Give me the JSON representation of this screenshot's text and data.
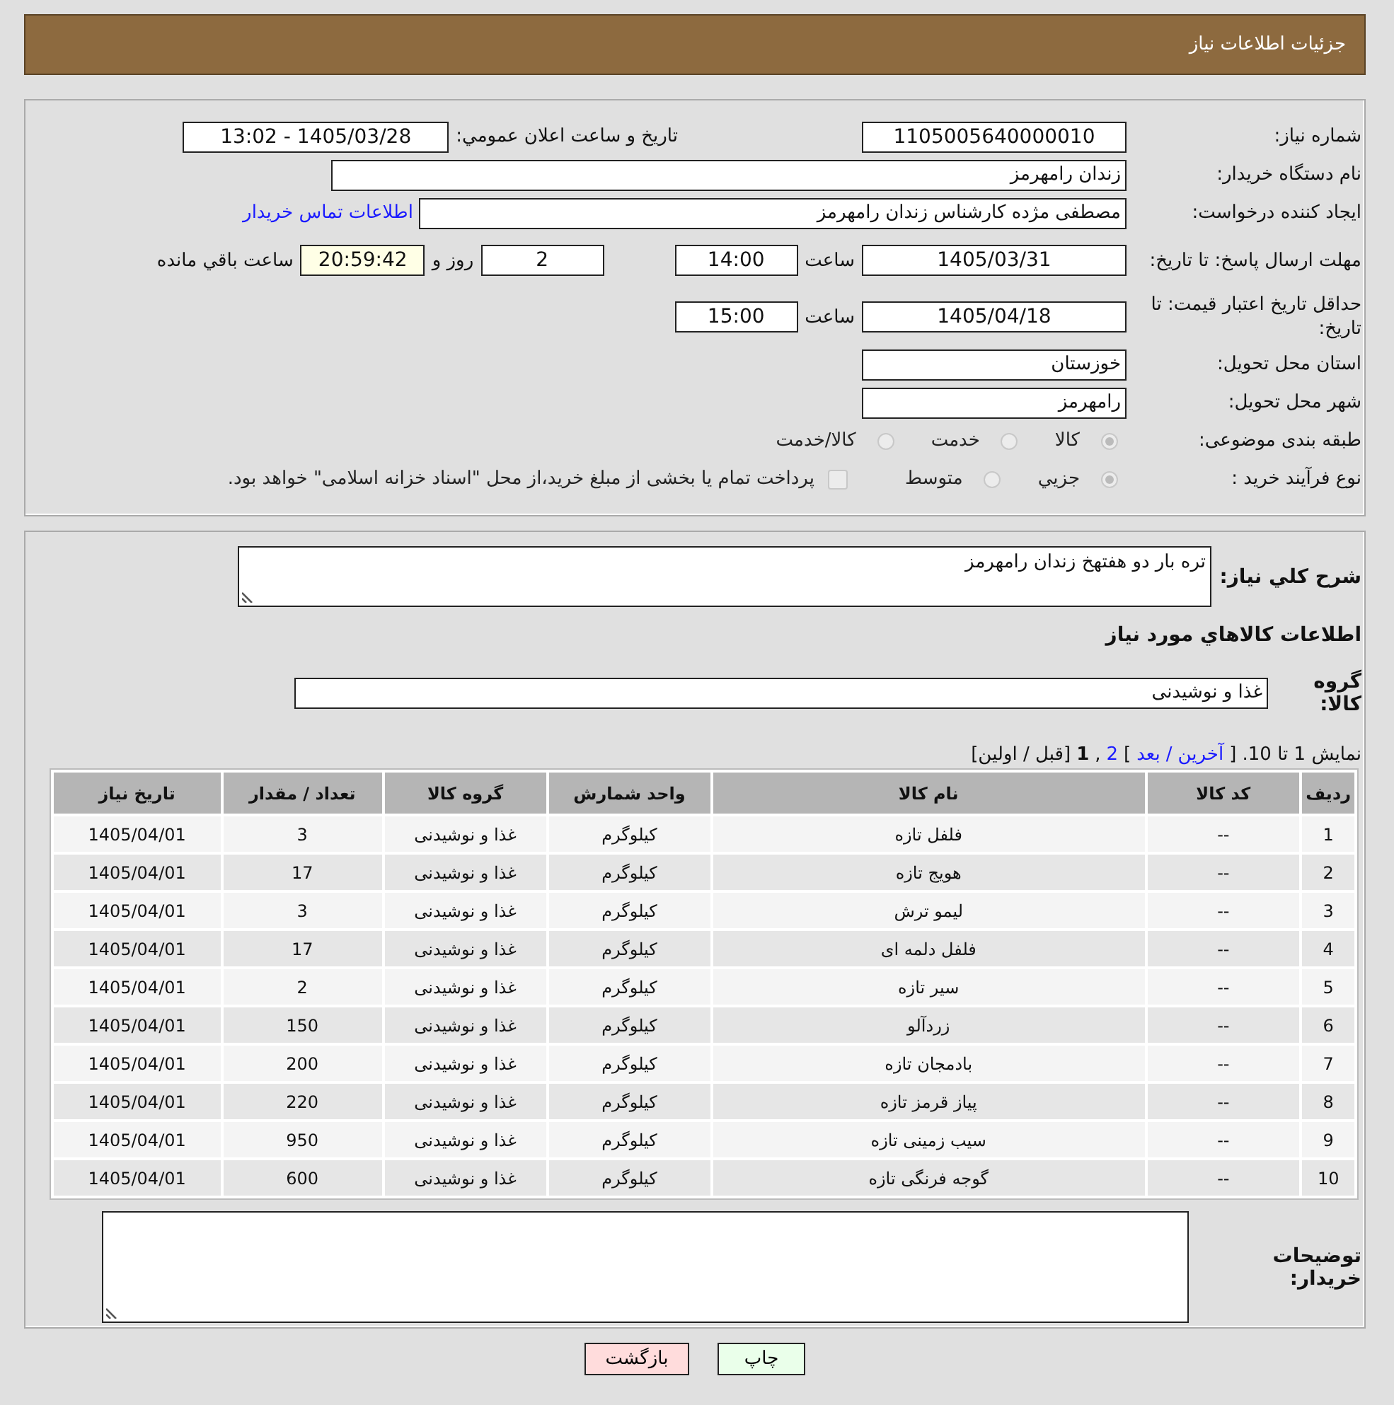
{
  "header": {
    "title": "جزئیات اطلاعات نیاز"
  },
  "details": {
    "need_number": {
      "label": "شماره نیاز:",
      "value": "1105005640000010"
    },
    "announce": {
      "label": "تاریخ و ساعت اعلان عمومي:",
      "value": "1405/03/28 - 13:02"
    },
    "buyer_org": {
      "label": "نام دستگاه خریدار:",
      "value": "زندان رامهرمز"
    },
    "requester": {
      "label": "ایجاد کننده درخواست:",
      "value": "مصطفی مژده کارشناس زندان رامهرمز",
      "link": "اطلاعات تماس خریدار"
    },
    "reply_deadline": {
      "label": "مهلت ارسال پاسخ: تا تاریخ:",
      "date": "1405/03/31",
      "time_label": "ساعت",
      "time": "14:00",
      "days": "2",
      "days_label": "روز و",
      "remaining": "20:59:42",
      "remaining_label": "ساعت باقي مانده"
    },
    "price_validity": {
      "label": "حداقل تاریخ اعتبار قیمت: تا تاریخ:",
      "date": "1405/04/18",
      "time_label": "ساعت",
      "time": "15:00"
    },
    "province": {
      "label": "استان محل تحویل:",
      "value": "خوزستان"
    },
    "city": {
      "label": "شهر محل تحویل:",
      "value": "رامهرمز"
    },
    "category": {
      "label": "طبقه بندی موضوعی:",
      "options": [
        {
          "label": "كالا",
          "selected": true
        },
        {
          "label": "خدمت",
          "selected": false
        },
        {
          "label": "كالا/خدمت",
          "selected": false
        }
      ]
    },
    "purchase_type": {
      "label": "نوع فرآیند خرید :",
      "options": [
        {
          "label": "جزيي",
          "selected": true
        },
        {
          "label": "متوسط",
          "selected": false
        }
      ],
      "treasury": {
        "label": "پرداخت تمام یا بخشی از مبلغ خرید،از محل \"اسناد خزانه اسلامی\" خواهد بود.",
        "checked": false
      }
    }
  },
  "need": {
    "description_label": "شرح كلي نياز:",
    "description": "تره بار دو هفتهخ زندان رامهرمز",
    "items_heading": "اطلاعات كالاهاي مورد نياز",
    "group_label": "گروه کالا:",
    "group": "غذا و نوشیدنی",
    "pagination": [
      {
        "kind": "text",
        "text": "نمایش 1 تا 10. ["
      },
      {
        "kind": "link",
        "text": "آخرین"
      },
      {
        "kind": "link",
        "text": "/"
      },
      {
        "kind": "link",
        "text": "بعد"
      },
      {
        "kind": "text",
        "text": "]"
      },
      {
        "kind": "link",
        "text": "2"
      },
      {
        "kind": "text",
        "text": ","
      },
      {
        "kind": "current",
        "text": "1"
      },
      {
        "kind": "text",
        "text": "[قبل / اولین]"
      }
    ],
    "table": {
      "columns": [
        "ردیف",
        "کد کالا",
        "نام کالا",
        "واحد شمارش",
        "گروه کالا",
        "تعداد / مقدار",
        "تاریخ نیاز"
      ],
      "rows": [
        [
          "1",
          "--",
          "فلفل تازه",
          "کیلوگرم",
          "غذا و نوشیدنی",
          "3",
          "1405/04/01"
        ],
        [
          "2",
          "--",
          "هویج تازه",
          "کیلوگرم",
          "غذا و نوشیدنی",
          "17",
          "1405/04/01"
        ],
        [
          "3",
          "--",
          "لیمو ترش",
          "کیلوگرم",
          "غذا و نوشیدنی",
          "3",
          "1405/04/01"
        ],
        [
          "4",
          "--",
          "فلفل دلمه ای",
          "کیلوگرم",
          "غذا و نوشیدنی",
          "17",
          "1405/04/01"
        ],
        [
          "5",
          "--",
          "سیر تازه",
          "کیلوگرم",
          "غذا و نوشیدنی",
          "2",
          "1405/04/01"
        ],
        [
          "6",
          "--",
          "زردآلو",
          "کیلوگرم",
          "غذا و نوشیدنی",
          "150",
          "1405/04/01"
        ],
        [
          "7",
          "--",
          "بادمجان تازه",
          "کیلوگرم",
          "غذا و نوشیدنی",
          "200",
          "1405/04/01"
        ],
        [
          "8",
          "--",
          "پیاز قرمز تازه",
          "کیلوگرم",
          "غذا و نوشیدنی",
          "220",
          "1405/04/01"
        ],
        [
          "9",
          "--",
          "سیب زمینی تازه",
          "کیلوگرم",
          "غذا و نوشیدنی",
          "950",
          "1405/04/01"
        ],
        [
          "10",
          "--",
          "گوجه فرنگی تازه",
          "کیلوگرم",
          "غذا و نوشیدنی",
          "600",
          "1405/04/01"
        ]
      ]
    },
    "notes_label": "توضیحات خریدار:"
  },
  "buttons": [
    {
      "kind": "print",
      "label": "چاپ"
    },
    {
      "kind": "back",
      "label": "بازگشت"
    }
  ]
}
